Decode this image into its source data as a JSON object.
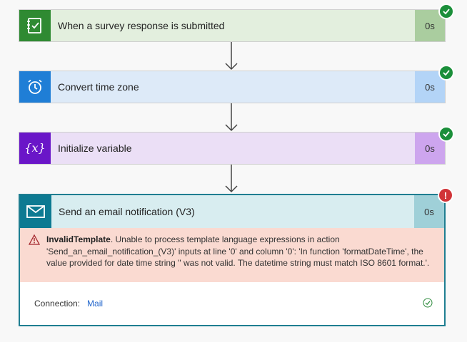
{
  "steps": [
    {
      "title": "When a survey response is submitted",
      "duration": "0s",
      "status": "success",
      "icon": "survey-checklist-icon"
    },
    {
      "title": "Convert time zone",
      "duration": "0s",
      "status": "success",
      "icon": "alarm-clock-icon"
    },
    {
      "title": "Initialize variable",
      "duration": "0s",
      "status": "success",
      "icon": "variable-x-icon"
    },
    {
      "title": "Send an email notification (V3)",
      "duration": "0s",
      "status": "failed",
      "icon": "mail-envelope-icon"
    }
  ],
  "error": {
    "label": "InvalidTemplate",
    "message": ". Unable to process template language expressions in action 'Send_an_email_notification_(V3)' inputs at line '0' and column '0': 'In function 'formatDateTime', the value provided for date time string '' was not valid. The datetime string must match ISO 8601 format.'."
  },
  "connection": {
    "label": "Connection:",
    "value": "Mail"
  },
  "colors": {
    "success": "#1b8f3a",
    "error": "#d13438",
    "trigger": "#2f8a32",
    "timezone": "#1f7ed6",
    "variable": "#6a16c8",
    "email": "#0d7a92"
  }
}
